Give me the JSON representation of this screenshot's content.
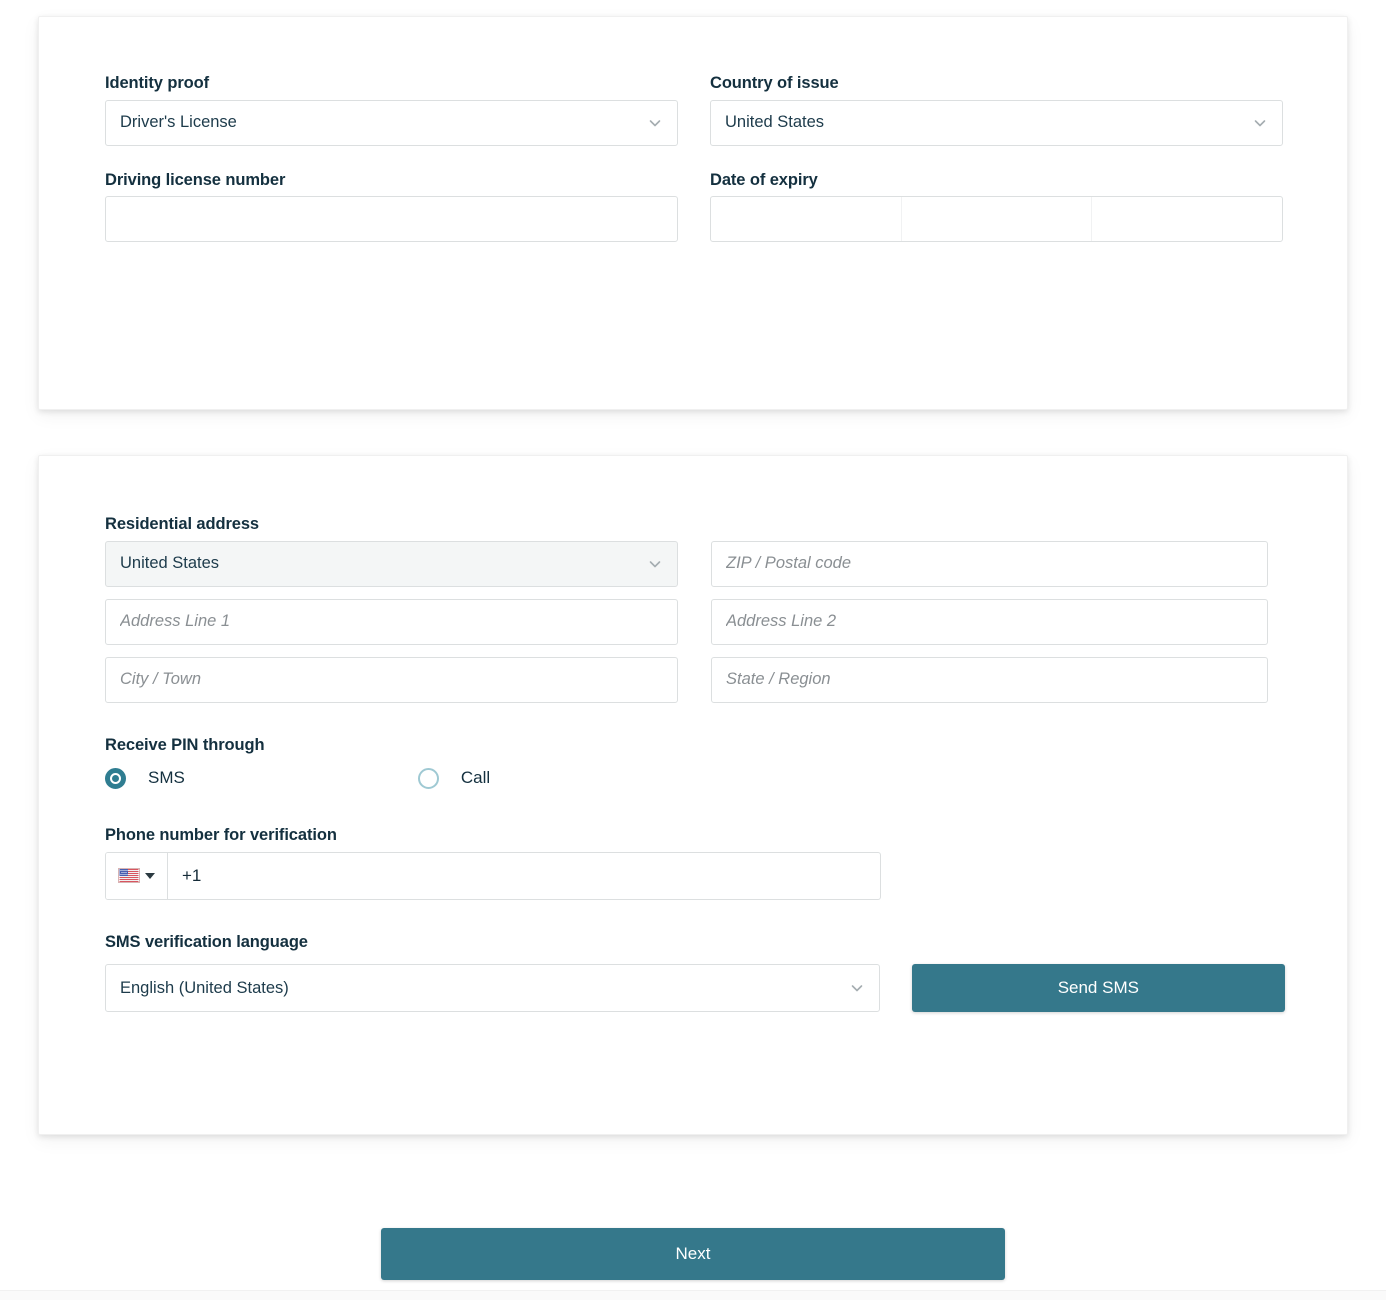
{
  "identity_card": {
    "fields": [
      {
        "label": "Identity proof",
        "type": "select",
        "value": "Driver's License",
        "icon": "chevron-down-icon"
      },
      {
        "label": "Country of issue",
        "type": "select",
        "value": "United States",
        "icon": "chevron-down-icon"
      },
      {
        "label": "Driving license number",
        "type": "text",
        "value": "",
        "placeholder": ""
      },
      {
        "label": "Date of expiry",
        "type": "date-segmented",
        "value": "",
        "segments": 3
      }
    ]
  },
  "address_card": {
    "residential_address_label": "Residential address",
    "country_value": "United States",
    "country_icon": "chevron-down-icon",
    "placeholders": {
      "zip": "ZIP / Postal code",
      "line1": "Address Line 1",
      "line2": "Address Line 2",
      "city": "City / Town",
      "state": "State / Region"
    },
    "receive_pin": {
      "label": "Receive PIN through",
      "options": [
        {
          "label": "SMS",
          "selected": true
        },
        {
          "label": "Call",
          "selected": false
        }
      ]
    },
    "phone": {
      "label": "Phone number for verification",
      "country_flag": "us-flag-icon",
      "country_caret": "caret-down-icon",
      "value": "+1"
    },
    "language": {
      "label": "SMS verification language",
      "value": "English (United States)",
      "icon": "chevron-down-icon"
    },
    "send_sms_label": "Send SMS"
  },
  "footer": {
    "next_label": "Next"
  },
  "colors": {
    "accent": "#35788b",
    "label_text": "#14303f",
    "placeholder_text": "#8a8f93",
    "border": "#dcdfe0",
    "radio_selected": "#2f7d91",
    "radio_unselected": "#9fc9d3",
    "filled_field_bg": "#f4f6f6",
    "page_bg": "#ffffff"
  }
}
